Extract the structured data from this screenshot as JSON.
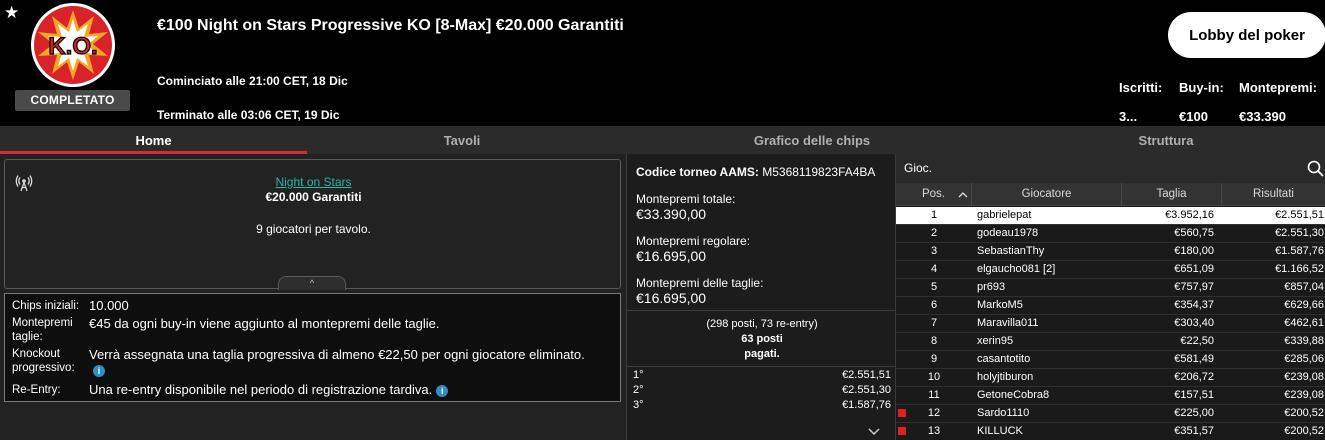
{
  "header": {
    "title": "€100 Night on Stars Progressive KO [8-Max] €20.000 Garantiti",
    "logo_text": "K.O.",
    "status_badge": "COMPLETATO",
    "started": "Cominciato alle 21:00 CET, 18 Dic",
    "ended": "Terminato alle 03:06 CET, 19 Dic",
    "lobby_button": "Lobby del poker",
    "stats": {
      "entrants_label": "Iscritti:",
      "entrants_value": "3...",
      "buyin_label": "Buy-in:",
      "buyin_value": "€100",
      "prize_label": "Montepremi:",
      "prize_value": "€33.390"
    },
    "icons": {
      "favorite": "star-icon"
    }
  },
  "tabs": [
    {
      "label": "Home",
      "active": true
    },
    {
      "label": "Tavoli",
      "active": false
    },
    {
      "label": "Grafico delle chips",
      "active": false
    },
    {
      "label": "Struttura",
      "active": false
    }
  ],
  "home": {
    "event_name": "Night on Stars",
    "guarantee": "€20.000 Garantiti",
    "players_per_table": "9 giocatori per tavolo.",
    "collapse_glyph": "^",
    "details": [
      {
        "label": "Chips iniziali:",
        "value": "10.000"
      },
      {
        "label": "Montepremi taglie:",
        "value": "€45 da ogni buy-in viene aggiunto al montepremi delle taglie."
      },
      {
        "label": "Knockout progressivo:",
        "value": "Verrà assegnata una taglia progressiva di almeno €22,50 per ogni giocatore eliminato."
      },
      {
        "label": "Re-Entry:",
        "value": "Una re-entry disponibile nel periodo di registrazione tardiva."
      }
    ],
    "info_glyph": "i"
  },
  "prize_info": {
    "aams_label": "Codice torneo AAMS:",
    "aams_code": "M5368119823FA4BA",
    "total_label": "Montepremi totale:",
    "total_value": "€33.390,00",
    "regular_label": "Montepremi regolare:",
    "regular_value": "€16.695,00",
    "bounty_label": "Montepremi delle taglie:",
    "bounty_value": "€16.695,00",
    "seats_line": "(298 posti, 73 re-entry)",
    "paid_line1": "63 posti",
    "paid_line2": "pagati.",
    "payouts": [
      {
        "place": "1°",
        "amount": "€2.551,51"
      },
      {
        "place": "2°",
        "amount": "€2.551,30"
      },
      {
        "place": "3°",
        "amount": "€1.587,76"
      }
    ]
  },
  "players": {
    "search_label": "Gioc.",
    "search_value": "",
    "search_placeholder": "",
    "columns": {
      "pos": "Pos.",
      "player": "Giocatore",
      "bounty": "Taglia",
      "results": "Risultati"
    },
    "rows": [
      {
        "pos": "1",
        "name": "gabrielepat",
        "bounty": "€3.952,16",
        "result": "€2.551,51",
        "selected": true,
        "flag": false
      },
      {
        "pos": "2",
        "name": "godeau1978",
        "bounty": "€560,75",
        "result": "€2.551,30",
        "selected": false,
        "flag": false
      },
      {
        "pos": "3",
        "name": "SebastianThy",
        "bounty": "€180,00",
        "result": "€1.587,76",
        "selected": false,
        "flag": false
      },
      {
        "pos": "4",
        "name": "elgaucho081 [2]",
        "bounty": "€651,09",
        "result": "€1.166,52",
        "selected": false,
        "flag": false
      },
      {
        "pos": "5",
        "name": "pr693",
        "bounty": "€757,97",
        "result": "€857,04",
        "selected": false,
        "flag": false
      },
      {
        "pos": "6",
        "name": "MarkoM5",
        "bounty": "€354,37",
        "result": "€629,66",
        "selected": false,
        "flag": false
      },
      {
        "pos": "7",
        "name": "Maravilla011",
        "bounty": "€303,40",
        "result": "€462,61",
        "selected": false,
        "flag": false
      },
      {
        "pos": "8",
        "name": "xerin95",
        "bounty": "€22,50",
        "result": "€339,88",
        "selected": false,
        "flag": false
      },
      {
        "pos": "9",
        "name": "casantotito",
        "bounty": "€581,49",
        "result": "€285,06",
        "selected": false,
        "flag": false
      },
      {
        "pos": "10",
        "name": "holyjtiburon",
        "bounty": "€206,72",
        "result": "€239,08",
        "selected": false,
        "flag": false
      },
      {
        "pos": "11",
        "name": "GetoneCobra8",
        "bounty": "€157,51",
        "result": "€239,08",
        "selected": false,
        "flag": false
      },
      {
        "pos": "12",
        "name": "Sardo1110",
        "bounty": "€225,00",
        "result": "€200,52",
        "selected": false,
        "flag": true
      },
      {
        "pos": "13",
        "name": "KILLUCK",
        "bounty": "€351,57",
        "result": "€200,52",
        "selected": false,
        "flag": true
      }
    ]
  },
  "colors": {
    "tab_underline": "#d9283a",
    "link": "#2bb3a3",
    "info_icon": "#2f8dc8",
    "flag": "#e02020",
    "logo_red": "#d8232a",
    "logo_orange": "#f5a623"
  }
}
